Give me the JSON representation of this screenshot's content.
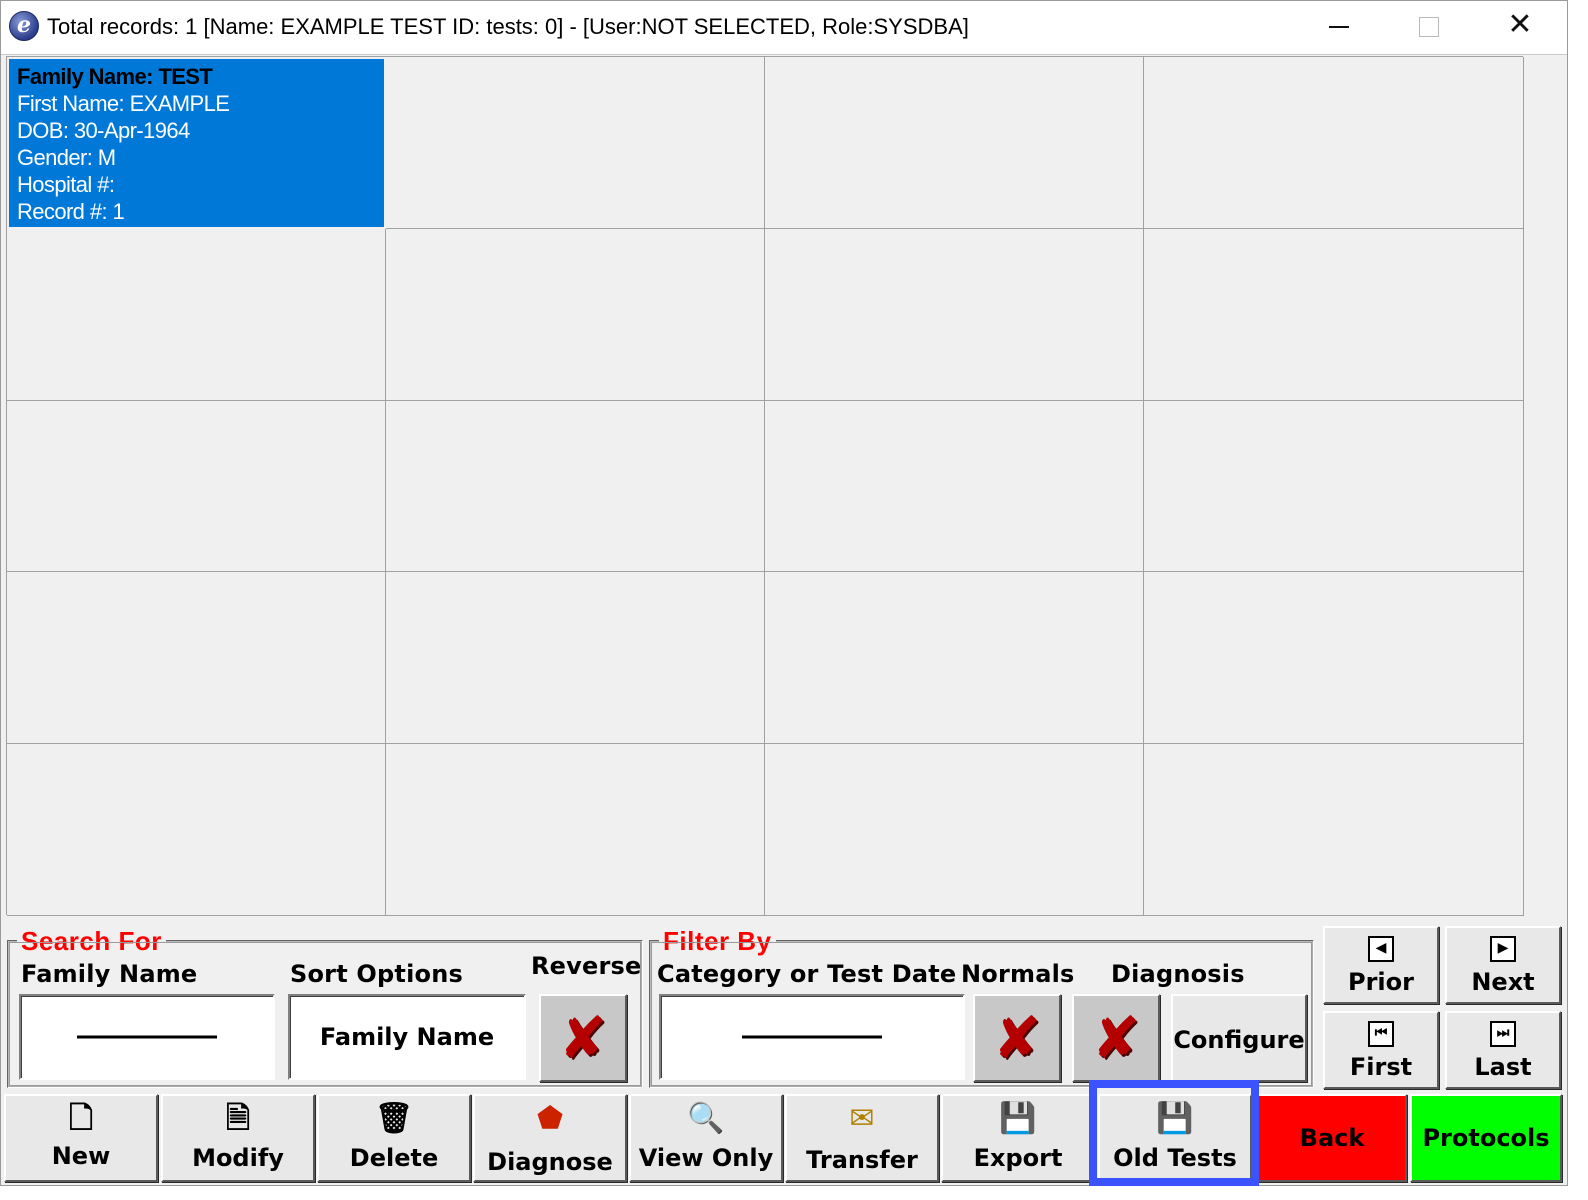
{
  "titlebar": {
    "icon_letter": "e",
    "title": "Total records: 1  [Name: EXAMPLE TEST ID:  tests: 0] - [User:NOT SELECTED, Role:SYSDBA]",
    "close_glyph": "✕"
  },
  "record": {
    "family_name": "Family Name: TEST",
    "first_name": "First Name: EXAMPLE",
    "dob": "DOB: 30-Apr-1964",
    "gender": "Gender: M",
    "hospital": "Hospital #:",
    "record_no": "Record #: 1"
  },
  "search": {
    "legend": "Search For",
    "family_name_label": "Family Name",
    "sort_options_label": "Sort Options",
    "sort_value": "Family Name",
    "reverse_label": "Reverse"
  },
  "filter": {
    "legend": "Filter By",
    "category_label": "Category or Test Date",
    "normals_label": "Normals",
    "diagnosis_label": "Diagnosis",
    "configure_label": "Configure"
  },
  "nav": {
    "prior": "Prior",
    "next": "Next",
    "first": "First",
    "last": "Last"
  },
  "toolbar": {
    "new": "New",
    "modify": "Modify",
    "delete": "Delete",
    "diagnose": "Diagnose",
    "view_only": "View Only",
    "transfer": "Transfer",
    "export": "Export",
    "old_tests": "Old Tests",
    "back": "Back",
    "protocols": "Protocols"
  },
  "colors": {
    "selected_cell": "#0078d7",
    "legend_text": "#ff0000",
    "back_button": "#ff0000",
    "protocols_button": "#00ff00",
    "highlight_box": "#3b52ff"
  },
  "icons": {
    "x_glyph": "✘",
    "prior_glyph": "◀",
    "next_glyph": "▶",
    "first_glyph": "⏮",
    "last_glyph": "⏭",
    "new_glyph": "🗋",
    "modify_glyph": "🗎",
    "delete_glyph": "🗑",
    "diagnose_glyph": "⬟",
    "view_glyph": "🔍",
    "transfer_glyph": "✉",
    "export_glyph": "💾",
    "old_tests_glyph": "💾"
  }
}
